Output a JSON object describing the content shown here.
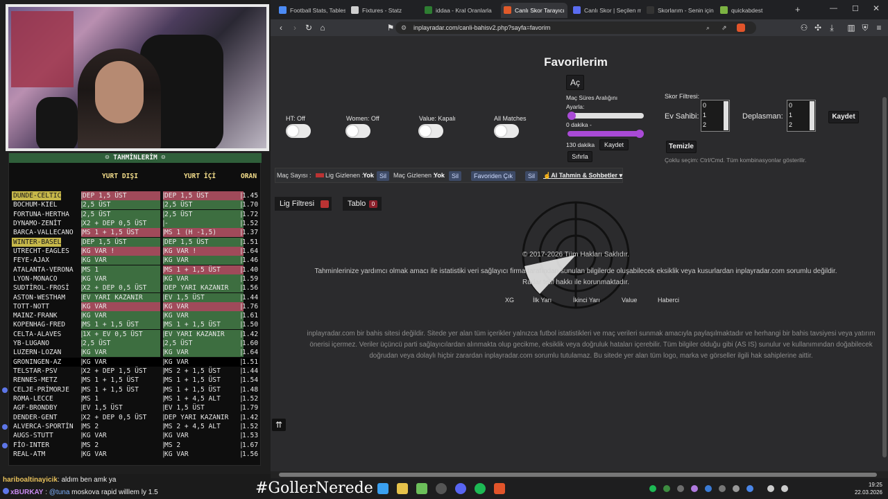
{
  "left_panel": {
    "title": "TAHMİNLERİM",
    "col_away": "YURT DIŞI",
    "col_home": "YURT İÇİ",
    "col_odds": "ORAN",
    "rows": [
      {
        "team": "DUNDE-CELTIC",
        "c1": "DEP 1,5 ÜST",
        "c2": "DEP 1,5 ÜST",
        "odds": "1.45",
        "hl": "red",
        "team_hl": "yel"
      },
      {
        "team": "BOCHUM-KIEL",
        "c1": "2,5 ÜST",
        "c2": "2,5 ÜST",
        "odds": "1.70",
        "hl": "green"
      },
      {
        "team": "FORTUNA-HERTHA",
        "c1": "2,5 ÜST",
        "c2": "2,5 ÜST",
        "odds": "1.72",
        "hl": "green"
      },
      {
        "team": "DYNAMO-ZENİT",
        "c1": "X2 + DEP 0,5 ÜST",
        "c2": "-",
        "odds": "1.52",
        "hl": "green"
      },
      {
        "team": "BARCA-VALLECANO",
        "c1": "MS 1 + 1,5 ÜST",
        "c2": "MS 1 (H -1,5)",
        "odds": "1.37",
        "hl": "red"
      },
      {
        "team": "WINTER-BASEL",
        "c1": "DEP 1,5 ÜST",
        "c2": "DEP 1,5 ÜST",
        "odds": "1.51",
        "hl": "green",
        "team_hl": "yel"
      },
      {
        "team": "UTRECHT-EAGLES",
        "c1": "KG VAR !",
        "c2": "KG VAR !",
        "odds": "1.64",
        "hl": "red"
      },
      {
        "team": "FEYE-AJAX",
        "c1": "KG VAR",
        "c2": "KG VAR",
        "odds": "1.46",
        "hl": "green"
      },
      {
        "team": "ATALANTA-VERONA",
        "c1": "MS 1",
        "c2": "MS 1 + 1,5 ÜST",
        "odds": "1.40",
        "hl": "green",
        "c2_hl": "red"
      },
      {
        "team": "LYON-MONACO",
        "c1": "KG VAR",
        "c2": "KG VAR",
        "odds": "1.59",
        "hl": "green"
      },
      {
        "team": "SUDTİROL-FROSİ",
        "c1": "X2 + DEP 0,5 ÜST",
        "c2": "DEP YARI KAZANIR",
        "odds": "1.56",
        "hl": "green"
      },
      {
        "team": "ASTON-WESTHAM",
        "c1": "EV YARI KAZANIR",
        "c2": "EV 1,5 ÜST",
        "odds": "1.44",
        "hl": "green"
      },
      {
        "team": "TOTT-NOTT",
        "c1": "KG VAR",
        "c2": "KG VAR",
        "odds": "1.76",
        "hl": "red"
      },
      {
        "team": "MAINZ-FRANK",
        "c1": "KG VAR",
        "c2": "KG VAR",
        "odds": "1.61",
        "hl": "green"
      },
      {
        "team": "KOPENHAG-FRED",
        "c1": "MS 1 + 1,5 ÜST",
        "c2": "MS 1 + 1,5 ÜST",
        "odds": "1.50",
        "hl": "green"
      },
      {
        "team": "CELTA-ALAVES",
        "c1": "1X + EV 0,5 ÜST",
        "c2": "EV YARI KAZANIR",
        "odds": "1.42",
        "hl": "green"
      },
      {
        "team": "YB-LUGANO",
        "c1": "2,5 ÜST",
        "c2": "2,5 ÜST",
        "odds": "1.60",
        "hl": "green"
      },
      {
        "team": "LUZERN-LOZAN",
        "c1": "KG VAR",
        "c2": "KG VAR",
        "odds": "1.64",
        "hl": "green"
      },
      {
        "team": "GRONINGEN-AZ",
        "c1": "KG VAR",
        "c2": "KG VAR",
        "odds": "1.51",
        "hl": "none"
      },
      {
        "team": "TELSTAR-PSV",
        "c1": "X2 + DEP 1,5 ÜST",
        "c2": "MS 2 + 1,5 ÜST",
        "odds": "1.44",
        "hl": "none"
      },
      {
        "team": "RENNES-METZ",
        "c1": "MS 1 + 1,5 ÜST",
        "c2": "MS 1 + 1,5 ÜST",
        "odds": "1.54",
        "hl": "none"
      },
      {
        "team": "CELJE-PRİMORJE",
        "c1": "MS 1 + 1,5 ÜST",
        "c2": "MS 1 + 1,5 ÜST",
        "odds": "1.48",
        "hl": "none",
        "dot": true
      },
      {
        "team": "ROMA-LECCE",
        "c1": "MS 1",
        "c2": "MS 1 + 4,5 ALT",
        "odds": "1.52",
        "hl": "none"
      },
      {
        "team": "AGF-BRONDBY",
        "c1": "EV 1,5 ÜST",
        "c2": "EV 1,5 ÜST",
        "odds": "1.79",
        "hl": "none"
      },
      {
        "team": "DENDER-GENT",
        "c1": "X2 + DEP 0,5 ÜST",
        "c2": "DEP YARI KAZANIR",
        "odds": "1.42",
        "hl": "none"
      },
      {
        "team": "ALVERCA-SPORTİN",
        "c1": "MS 2",
        "c2": "MS 2 + 4,5 ALT",
        "odds": "1.52",
        "hl": "none",
        "dot": true
      },
      {
        "team": "AUGS-STUTT",
        "c1": "KG VAR",
        "c2": "KG VAR",
        "odds": "1.53",
        "hl": "none"
      },
      {
        "team": "FİO-INTER",
        "c1": "MS 2",
        "c2": "MS 2",
        "odds": "1.67",
        "hl": "none",
        "dot": true
      },
      {
        "team": "REAL-ATM",
        "c1": "KG VAR",
        "c2": "KG VAR",
        "odds": "1.56",
        "hl": "none"
      }
    ]
  },
  "chat": {
    "msg1_user": "hariboaltinayicik",
    "msg1_text": ": aldım ben amk ya",
    "msg2_user": "xBURKAY",
    "msg2_sep": " : ",
    "msg2_mention": "@tuna",
    "msg2_text": " moskova rapid willlem ly 1.5"
  },
  "overlay_hashtag": "#GollerNerede",
  "browser": {
    "tabs": [
      {
        "label": "Football Stats, Tables",
        "color": "#4c8bf5"
      },
      {
        "label": "Fixtures - Statz",
        "color": "#cfcfcf"
      },
      {
        "label": "iddaa - Kral Oranlarla",
        "color": "#2e7d32"
      },
      {
        "label": "Canlı Skor Tarayıcı",
        "color": "#e05a2a"
      },
      {
        "label": "Canlı Skor | Seçilen m",
        "color": "#5a6cf0"
      },
      {
        "label": "Skorlarım - Senin için",
        "color": "#333333"
      },
      {
        "label": "quickabdest",
        "color": "#7cb342"
      }
    ],
    "new_tab": "+",
    "url": "inplayradar.com/canli-bahisv2.php?sayfa=favorim"
  },
  "page": {
    "title": "Favorilerim",
    "ac_button": "Aç",
    "toggles": [
      {
        "label": "HT: Off"
      },
      {
        "label": "Women: Off"
      },
      {
        "label": "Value: Kapalı"
      },
      {
        "label": "All Matches"
      }
    ],
    "time_range_title": "Maç Süres Aralığını",
    "time_range_sub": "Ayarla:",
    "min_label": "0 dakika -",
    "max_label": "130 dakika",
    "save_label": "Kaydet",
    "reset_label": "Sıfırla",
    "score_filter_title": "Skor Filtresi:",
    "home_label": "Ev Sahibi:",
    "away_label": "Deplasman:",
    "home_options": [
      "0",
      "1",
      "2"
    ],
    "away_options": [
      "0",
      "1",
      "2"
    ],
    "score_save": "Kaydet",
    "clear_label": "Temizle",
    "multi_hint": "Çoklu seçim: Ctrl/Cmd. Tüm kombinasyonlar gösterilir.",
    "infobar": {
      "mac_sayisi": "Maç Sayısı :",
      "lig_gizlenen": "Lig Gizlenen :",
      "yok1": "Yok",
      "sil1": "Sil",
      "mac_gizlenen": "Maç Gizlenen :",
      "yok2": "Yok",
      "sil2": "Sil",
      "favoriden": "Favoriden Çık",
      "sil3": "Sil",
      "ai": "AI Tahmin & Sohbetler"
    },
    "lig_filtresi": "Lig Filtresi",
    "tablo": "Tablo",
    "tablo_count": "0",
    "copyright": "© 2017-2026 Tüm Hakları Saklıdır.",
    "disclaimer1": "Tahminlerinize yardımcı olmak amacı ile istatistiki veri sağlayıcı firma tarafından sunulan bilgilerde oluşabilecek eksiklik veya kusurlardan inplayradar.com sorumlu değildir.",
    "disclaimer2": "Radar telif hakkı ile korunmaktadır.",
    "footer_links": [
      "XG",
      "İlk Yarı",
      "İkinci Yarı",
      "Value",
      "Haberci"
    ],
    "legal": "inplayradar.com bir bahis sitesi değildir. Sitede yer alan tüm içerikler yalnızca futbol istatistikleri ve maç verileri sunmak amacıyla paylaşılmaktadır ve herhangi bir bahis tavsiyesi veya yatırım önerisi içermez. Veriler üçüncü parti sağlayıcılardan alınmakta olup gecikme, eksiklik veya doğruluk hataları içerebilir. Tüm bilgiler olduğu gibi (AS IS) sunulur ve kullanımından doğabilecek doğrudan veya dolaylı hiçbir zarardan inplayradar.com sorumlu tutulamaz. Bu sitede yer alan tüm logo, marka ve görseller ilgili hak sahiplerine aittir.",
    "scroll_top": "⇈"
  },
  "taskbar": {
    "time": "19:25",
    "date": "22.03.2026"
  },
  "colors": {
    "accent": "#a94ad6",
    "red": "#a04a5a",
    "green": "#3d6e40",
    "highlight": "#c7b84a"
  }
}
